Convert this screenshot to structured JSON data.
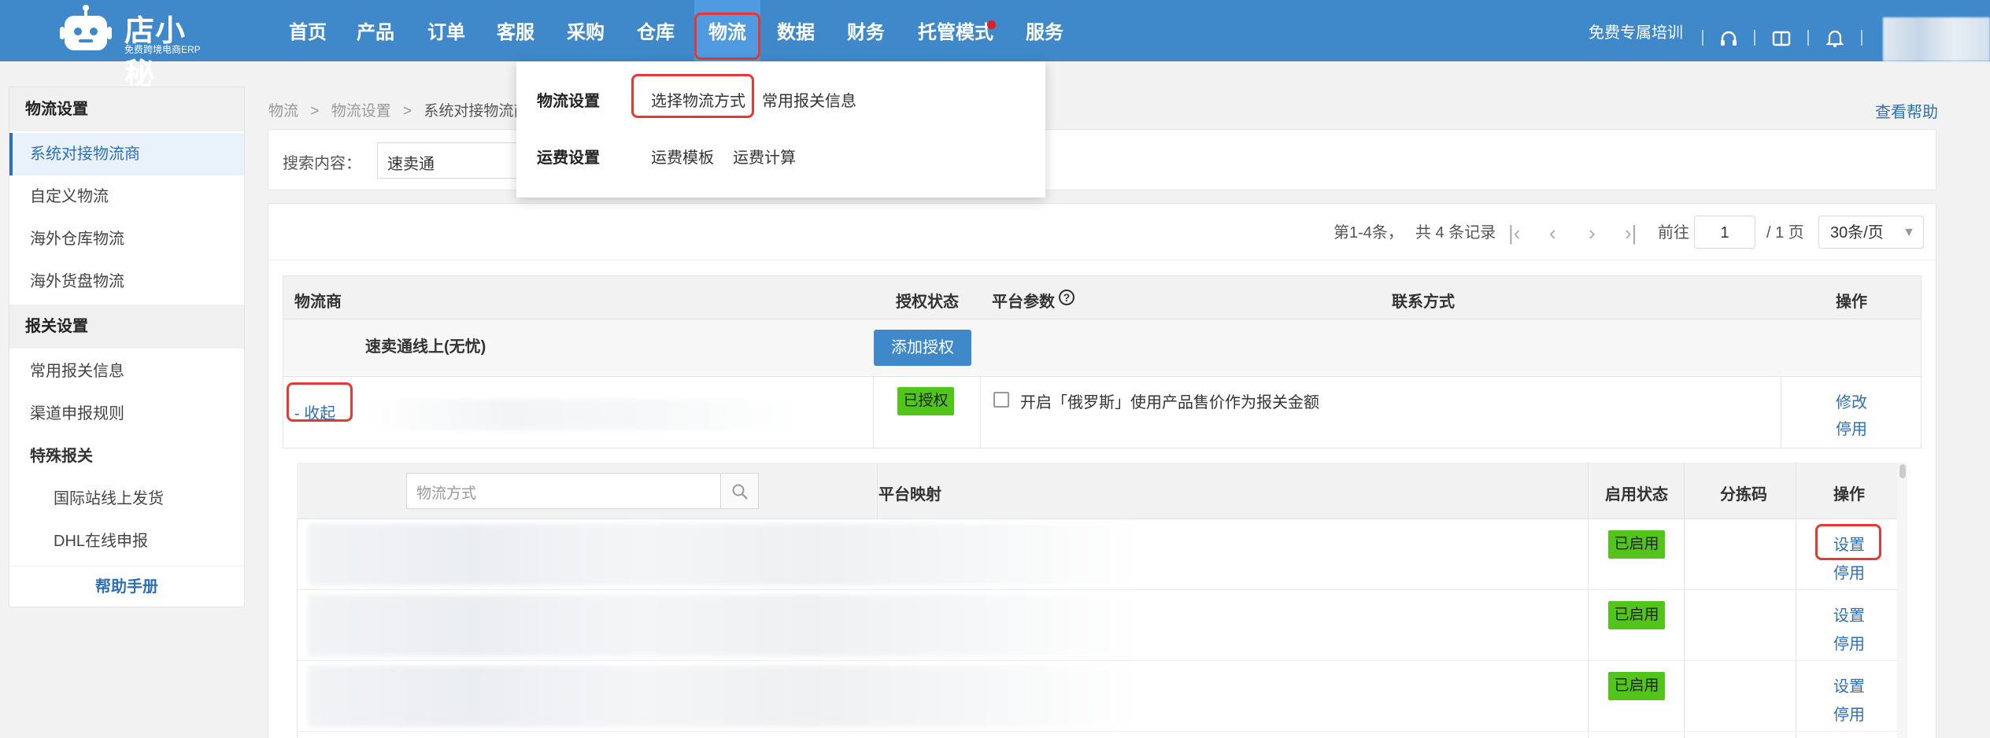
{
  "header": {
    "brand": "店小秘",
    "brand_sub": "免费跨境电商ERP",
    "nav": [
      "首页",
      "产品",
      "订单",
      "客服",
      "采购",
      "仓库",
      "物流",
      "数据",
      "财务",
      "托管模式",
      "服务"
    ],
    "active_nav": "物流",
    "training": "免费专属培训"
  },
  "dropdown": {
    "logistics_settings": "物流设置",
    "select_method": "选择物流方式",
    "customs_info": "常用报关信息",
    "freight_settings": "运费设置",
    "freight_template": "运费模板",
    "freight_calc": "运费计算"
  },
  "sidebar": {
    "section1": "物流设置",
    "items1": [
      "系统对接物流商",
      "自定义物流",
      "海外仓库物流",
      "海外货盘物流"
    ],
    "section2": "报关设置",
    "items2": [
      "常用报关信息",
      "渠道申报规则"
    ],
    "special": "特殊报关",
    "sub_items": [
      "国际站线上发货",
      "DHL在线申报"
    ],
    "help": "帮助手册"
  },
  "breadcrumb": {
    "l1": "物流",
    "sep": ">",
    "l2": "物流设置",
    "l3": "系统对接物流商"
  },
  "help_link": "查看帮助",
  "search": {
    "label": "搜索内容：",
    "value": "速卖通"
  },
  "pager": {
    "range": "第1-4条，",
    "total": "共 4 条记录",
    "goto": "前往",
    "page": "1",
    "pages": "/ 1 页",
    "per_page": "30条/页"
  },
  "table": {
    "col_carrier": "物流商",
    "col_auth": "授权状态",
    "col_params": "平台参数",
    "col_contact": "联系方式",
    "col_action": "操作",
    "group_name": "速卖通线上(无忧)",
    "add_auth": "添加授权",
    "collapse": "- 收起",
    "auth_status": "已授权",
    "param_option": "开启「俄罗斯」使用产品售价作为报关金额",
    "edit": "修改",
    "disable": "停用"
  },
  "subtable": {
    "search_placeholder": "物流方式",
    "col_mapping": "平台映射",
    "col_status": "启用状态",
    "col_sort": "分拣码",
    "col_action": "操作",
    "rows": [
      {
        "status": "已启用",
        "set": "设置",
        "disable": "停用"
      },
      {
        "status": "已启用",
        "set": "设置",
        "disable": "停用"
      },
      {
        "status": "已启用",
        "set": "设置",
        "disable": "停用"
      }
    ]
  },
  "colors": {
    "header_bg": "#3f88c9",
    "nav_active_bg": "#4f9ae0",
    "link": "#2f6fb5",
    "badge_green": "#52c41a",
    "highlight_red": "#e53935"
  }
}
